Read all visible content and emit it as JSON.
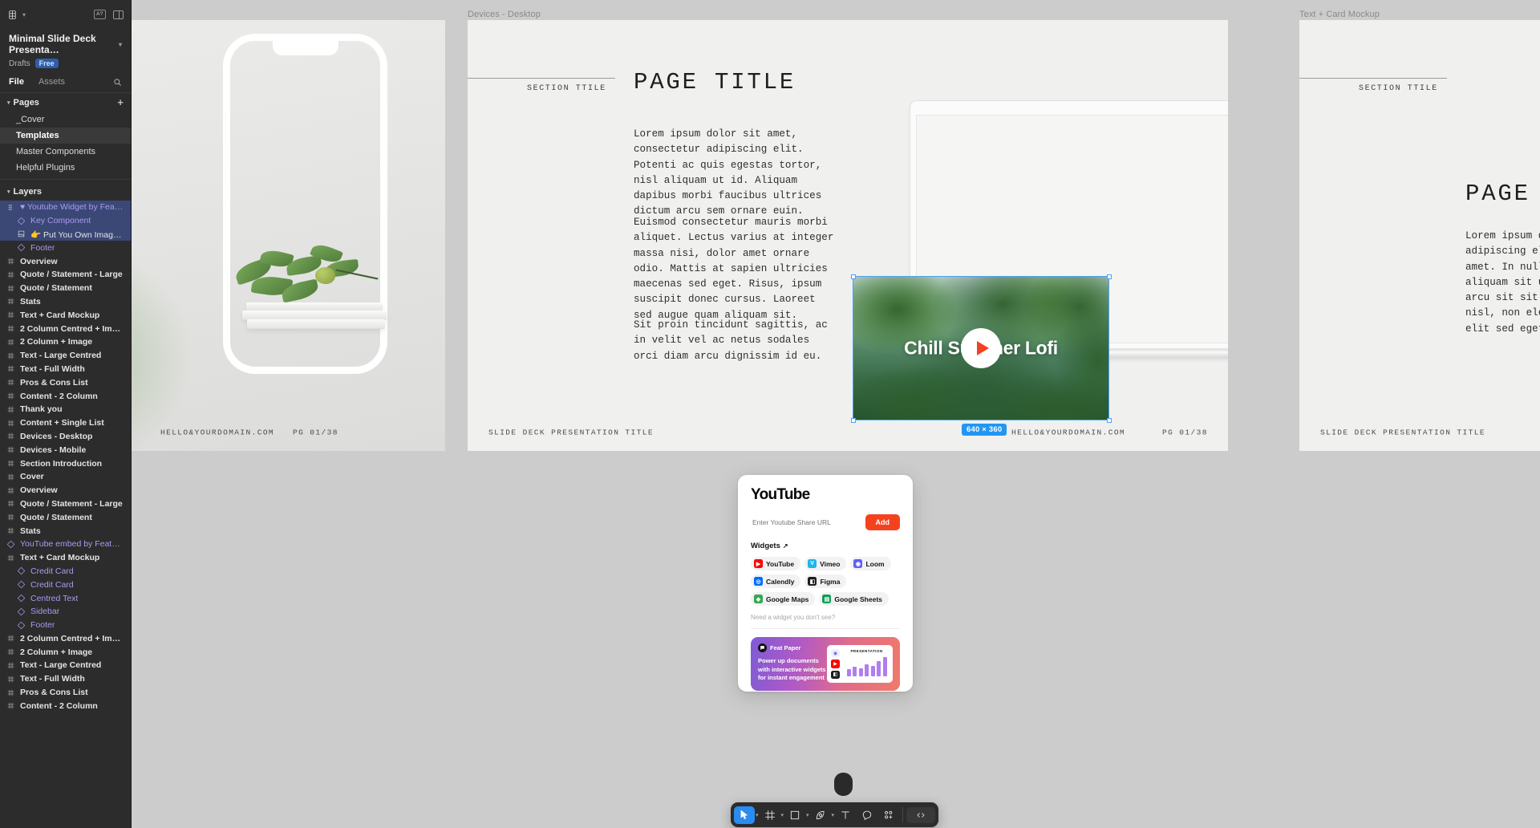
{
  "app": {
    "file_name": "Minimal Slide Deck Presenta…",
    "drafts_label": "Drafts",
    "plan_badge": "Free",
    "tabs": [
      {
        "label": "File",
        "active": true
      },
      {
        "label": "Assets",
        "active": false
      }
    ]
  },
  "pages": {
    "section_label": "Pages",
    "add_label": "+",
    "items": [
      {
        "label": "_Cover",
        "active": false
      },
      {
        "label": "Templates",
        "active": true
      },
      {
        "label": "Master Components",
        "active": false
      },
      {
        "label": "Helpful Plugins",
        "active": false
      }
    ]
  },
  "layers": {
    "section_label": "Layers",
    "items": [
      {
        "label": "♥ Youtube Widget by FeatPaper",
        "icon": "drag-handle-icon",
        "indent": 0,
        "selected": true,
        "style": "purple-selected"
      },
      {
        "label": "Key Component",
        "icon": "component-icon",
        "indent": 1,
        "selected": true,
        "style": "purple-selected"
      },
      {
        "label": "👉 Put You Own Image 👈",
        "icon": "image-icon",
        "indent": 1,
        "selected": true,
        "style": "plain-selected"
      },
      {
        "label": "Footer",
        "icon": "component-instance-icon",
        "indent": 1,
        "selected": false,
        "style": "purple"
      },
      {
        "label": "Overview",
        "icon": "frame-icon",
        "indent": 0,
        "selected": false,
        "style": "bold"
      },
      {
        "label": "Quote / Statement - Large",
        "icon": "frame-icon",
        "indent": 0,
        "selected": false,
        "style": "bold"
      },
      {
        "label": "Quote / Statement",
        "icon": "frame-icon",
        "indent": 0,
        "selected": false,
        "style": "bold"
      },
      {
        "label": "Stats",
        "icon": "frame-icon",
        "indent": 0,
        "selected": false,
        "style": "bold"
      },
      {
        "label": "Text + Card Mockup",
        "icon": "frame-icon",
        "indent": 0,
        "selected": false,
        "style": "bold"
      },
      {
        "label": "2 Column Centred + Image",
        "icon": "frame-icon",
        "indent": 0,
        "selected": false,
        "style": "bold"
      },
      {
        "label": "2 Column + Image",
        "icon": "frame-icon",
        "indent": 0,
        "selected": false,
        "style": "bold"
      },
      {
        "label": "Text - Large Centred",
        "icon": "frame-icon",
        "indent": 0,
        "selected": false,
        "style": "bold"
      },
      {
        "label": "Text - Full Width",
        "icon": "frame-icon",
        "indent": 0,
        "selected": false,
        "style": "bold"
      },
      {
        "label": "Pros & Cons List",
        "icon": "frame-icon",
        "indent": 0,
        "selected": false,
        "style": "bold"
      },
      {
        "label": "Content - 2 Column",
        "icon": "frame-icon",
        "indent": 0,
        "selected": false,
        "style": "bold"
      },
      {
        "label": "Thank you",
        "icon": "frame-icon",
        "indent": 0,
        "selected": false,
        "style": "bold"
      },
      {
        "label": "Content + Single List",
        "icon": "frame-icon",
        "indent": 0,
        "selected": false,
        "style": "bold"
      },
      {
        "label": "Devices - Desktop",
        "icon": "frame-icon",
        "indent": 0,
        "selected": false,
        "style": "bold"
      },
      {
        "label": "Devices - Mobile",
        "icon": "frame-icon",
        "indent": 0,
        "selected": false,
        "style": "bold"
      },
      {
        "label": "Section Introduction",
        "icon": "frame-icon",
        "indent": 0,
        "selected": false,
        "style": "bold"
      },
      {
        "label": "Cover",
        "icon": "frame-icon",
        "indent": 0,
        "selected": false,
        "style": "bold"
      },
      {
        "label": "Overview",
        "icon": "frame-icon",
        "indent": 0,
        "selected": false,
        "style": "bold"
      },
      {
        "label": "Quote / Statement - Large",
        "icon": "frame-icon",
        "indent": 0,
        "selected": false,
        "style": "bold"
      },
      {
        "label": "Quote / Statement",
        "icon": "frame-icon",
        "indent": 0,
        "selected": false,
        "style": "bold"
      },
      {
        "label": "Stats",
        "icon": "frame-icon",
        "indent": 0,
        "selected": false,
        "style": "bold"
      },
      {
        "label": "YouTube embed by FeatPaper",
        "icon": "component-instance-icon",
        "indent": 0,
        "selected": false,
        "style": "purple"
      },
      {
        "label": "Text + Card Mockup",
        "icon": "frame-icon",
        "indent": 0,
        "selected": false,
        "style": "bold"
      },
      {
        "label": "Credit Card",
        "icon": "component-instance-icon",
        "indent": 1,
        "selected": false,
        "style": "purple"
      },
      {
        "label": "Credit Card",
        "icon": "component-instance-icon",
        "indent": 1,
        "selected": false,
        "style": "purple"
      },
      {
        "label": "Centred Text",
        "icon": "component-instance-icon",
        "indent": 1,
        "selected": false,
        "style": "purple"
      },
      {
        "label": "Sidebar",
        "icon": "component-instance-icon",
        "indent": 1,
        "selected": false,
        "style": "purple"
      },
      {
        "label": "Footer",
        "icon": "component-instance-icon",
        "indent": 1,
        "selected": false,
        "style": "purple"
      },
      {
        "label": "2 Column Centred + Image",
        "icon": "frame-icon",
        "indent": 0,
        "selected": false,
        "style": "bold"
      },
      {
        "label": "2 Column + Image",
        "icon": "frame-icon",
        "indent": 0,
        "selected": false,
        "style": "bold"
      },
      {
        "label": "Text - Large Centred",
        "icon": "frame-icon",
        "indent": 0,
        "selected": false,
        "style": "bold"
      },
      {
        "label": "Text - Full Width",
        "icon": "frame-icon",
        "indent": 0,
        "selected": false,
        "style": "bold"
      },
      {
        "label": "Pros & Cons List",
        "icon": "frame-icon",
        "indent": 0,
        "selected": false,
        "style": "bold"
      },
      {
        "label": "Content - 2 Column",
        "icon": "frame-icon",
        "indent": 0,
        "selected": false,
        "style": "bold"
      }
    ]
  },
  "canvas": {
    "frames": [
      {
        "name": "Devices - Desktop"
      },
      {
        "name": "Text + Card Mockup"
      }
    ],
    "slide_left": {
      "footer_domain": "HELLO&YOURDOMAIN.COM",
      "footer_page": "PG 01/38"
    },
    "slide_center": {
      "section_title": "SECTION TTILE",
      "page_title": "PAGE TITLE",
      "paragraph_1": "Lorem ipsum dolor sit amet,\nconsectetur adipiscing elit.\nPotenti ac quis egestas tortor,\nnisl aliquam ut id. Aliquam\ndapibus morbi faucibus ultrices\ndictum arcu sem ornare euin.",
      "paragraph_2": "Euismod consectetur mauris morbi\naliquet. Lectus varius at integer\nmassa nisi, dolor amet ornare\nodio. Mattis at sapien ultricies\nmaecenas sed eget. Risus, ipsum\nsuscipit donec cursus. Laoreet\nsed augue quam aliquam sit.",
      "paragraph_3": "Sit proin tincidunt sagittis, ac\nin velit vel ac netus sodales\norci diam arcu dignissim id eu.",
      "footer_title": "SLIDE DECK PRESENTATION TITLE",
      "footer_domain": "HELLO&YOURDOMAIN.COM",
      "footer_page": "PG 01/38"
    },
    "slide_right": {
      "section_title": "SECTION TTILE",
      "page_title": "PAGE TI",
      "paragraph_1": "Lorem ipsum d\nadipiscing el\namet. In null\naliquam sit u\narcu sit sit.\nnisl, non ele\nelit sed eget",
      "footer_title": "SLIDE DECK PRESENTATION TITLE"
    },
    "selection": {
      "video_title": "Chill Summer Lofi",
      "dimensions_badge": "640 × 360",
      "selection_color": "#4aa3ef"
    }
  },
  "widget_popup": {
    "title": "YouTube",
    "url_placeholder": "Enter Youtube Share URL",
    "url_value": "",
    "add_label": "Add",
    "widgets_label": "Widgets",
    "widgets_arrow": "↗",
    "chips": [
      {
        "label": "YouTube",
        "icon": "youtube-icon",
        "color": "#ff0000"
      },
      {
        "label": "Vimeo",
        "icon": "vimeo-icon",
        "color": "#1ab7ea"
      },
      {
        "label": "Loom",
        "icon": "loom-icon",
        "color": "#625df5"
      },
      {
        "label": "Calendly",
        "icon": "calendly-icon",
        "color": "#006bff"
      },
      {
        "label": "Figma",
        "icon": "figma-icon",
        "color": "#1e1e1e"
      },
      {
        "label": "Google Maps",
        "icon": "google-maps-icon",
        "color": "#34a853"
      },
      {
        "label": "Google Sheets",
        "icon": "google-sheets-icon",
        "color": "#0f9d58"
      }
    ],
    "note": "Need a widget you don't see?",
    "promo": {
      "brand": "Feat Paper",
      "copy": "Power up documents\nwith interactive widgets\nfor instant engagement",
      "card_label": "PRESENTATION",
      "card_bars": [
        9,
        12,
        10,
        15,
        13,
        19,
        24
      ],
      "gradient_from": "#7f5bd6",
      "gradient_to": "#f07a6a"
    }
  },
  "toolbar": {
    "tools": [
      {
        "name": "move-tool",
        "icon": "cursor-icon",
        "active": true,
        "has_chevron": true
      },
      {
        "name": "frame-tool",
        "icon": "frame-icon",
        "active": false,
        "has_chevron": true
      },
      {
        "name": "shape-tool",
        "icon": "rectangle-icon",
        "active": false,
        "has_chevron": true
      },
      {
        "name": "pen-tool",
        "icon": "pen-icon",
        "active": false,
        "has_chevron": true
      },
      {
        "name": "text-tool",
        "icon": "text-icon",
        "active": false,
        "has_chevron": false
      },
      {
        "name": "comment-tool",
        "icon": "comment-icon",
        "active": false,
        "has_chevron": false
      },
      {
        "name": "actions-tool",
        "icon": "add-component-icon",
        "active": false,
        "has_chevron": false
      }
    ],
    "dev_mode": {
      "name": "dev-mode-toggle",
      "icon": "code-icon"
    }
  }
}
